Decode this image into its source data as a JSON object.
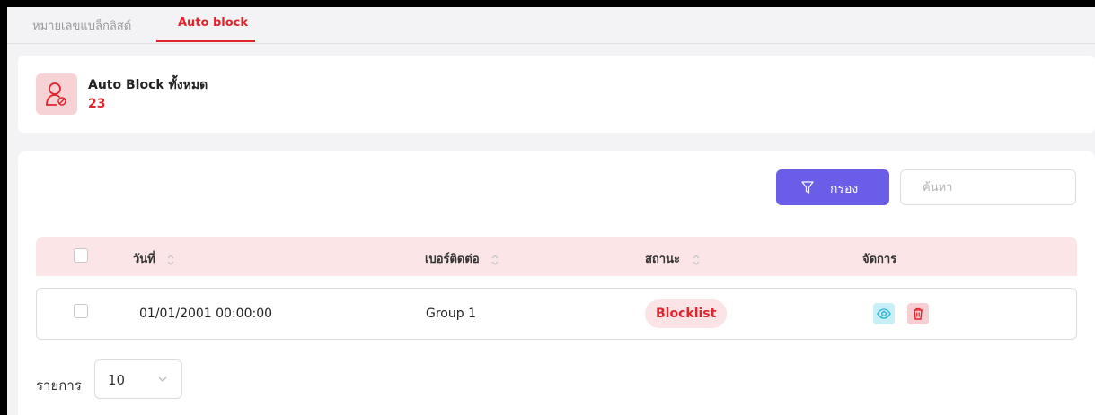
{
  "tabs": [
    {
      "label": "หมายเลขแบล็กลิสต์",
      "active": false
    },
    {
      "label": "Auto block",
      "active": true
    }
  ],
  "summary": {
    "title": "Auto Block ทั้งหมด",
    "count": "23",
    "icon": "user-block-icon"
  },
  "toolbar": {
    "filter_label": "กรอง",
    "search_placeholder": "ค้นหา",
    "search_value": ""
  },
  "table": {
    "columns": [
      "วันที่",
      "เบอร์ติดต่อ",
      "สถานะ",
      "จัดการ"
    ],
    "rows": [
      {
        "date": "01/01/2001 00:00:00",
        "contact": "Group 1",
        "status": "Blocklist"
      }
    ]
  },
  "pagination": {
    "label": "รายการ",
    "page_size": "10"
  },
  "colors": {
    "accent": "#e0242c",
    "filter_button": "#6a5de8",
    "header_bg": "#fce5e7",
    "view_button": "#c8eef6",
    "delete_button": "#f7cfd2"
  }
}
